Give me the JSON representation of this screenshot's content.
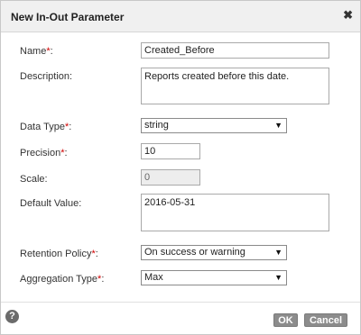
{
  "dialog": {
    "title": "New In-Out Parameter",
    "close_glyph": "✖"
  },
  "form": {
    "name": {
      "label": "Name",
      "required": "*",
      "colon": ":",
      "value": "Created_Before"
    },
    "description": {
      "label": "Description:",
      "value": "Reports created before this date."
    },
    "data_type": {
      "label": "Data Type",
      "required": "*",
      "colon": ":",
      "value": "string"
    },
    "precision": {
      "label": "Precision",
      "required": "*",
      "colon": ":",
      "value": "10"
    },
    "scale": {
      "label": "Scale:",
      "value": "0"
    },
    "default_value": {
      "label": "Default Value:",
      "value": "2016-05-31"
    },
    "retention_policy": {
      "label": "Retention Policy",
      "required": "*",
      "colon": ":",
      "value": "On success or warning"
    },
    "aggregation_type": {
      "label": "Aggregation Type",
      "required": "*",
      "colon": ":",
      "value": "Max"
    }
  },
  "footer": {
    "help_glyph": "?",
    "ok_label": "OK",
    "cancel_label": "Cancel"
  },
  "icons": {
    "select_arrow": "▼"
  }
}
